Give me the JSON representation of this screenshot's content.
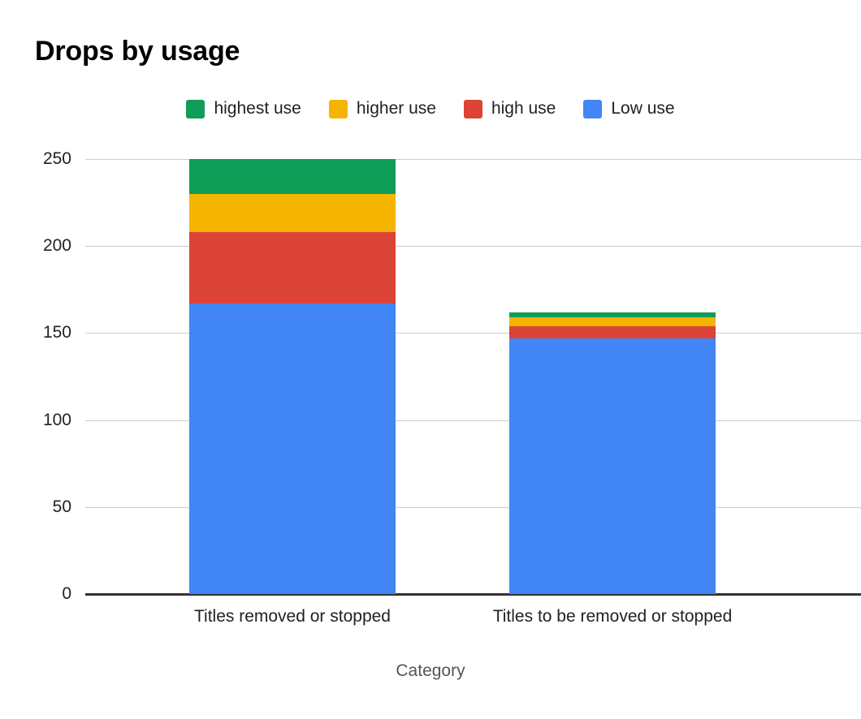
{
  "chart_data": {
    "type": "bar",
    "subtype": "stacked-column",
    "title": "Drops by usage",
    "xlabel": "Category",
    "ylabel": "",
    "categories": [
      "Titles removed or stopped",
      "Titles to be removed or stopped"
    ],
    "series": [
      {
        "name": "Low use",
        "color": "#4285f4",
        "values": [
          167,
          147
        ]
      },
      {
        "name": "high use",
        "color": "#db4437",
        "values": [
          41,
          7
        ]
      },
      {
        "name": "higher use",
        "color": "#f4b400",
        "values": [
          22,
          5
        ]
      },
      {
        "name": "highest use",
        "color": "#0f9d58",
        "values": [
          20,
          3
        ]
      }
    ],
    "stack_order_bottom_to_top": [
      "Low use",
      "high use",
      "higher use",
      "highest use"
    ],
    "totals": [
      250,
      162
    ],
    "ylim": [
      0,
      250
    ],
    "yticks": [
      "0",
      "50",
      "100",
      "150",
      "200",
      "250"
    ],
    "ytick_values": [
      0,
      50,
      100,
      150,
      200,
      250
    ],
    "grid": true,
    "legend_position": "top-center",
    "legend": [
      {
        "label": "highest use",
        "color": "#0f9d58"
      },
      {
        "label": "higher use",
        "color": "#f4b400"
      },
      {
        "label": "high use",
        "color": "#db4437"
      },
      {
        "label": "Low use",
        "color": "#4285f4"
      }
    ]
  },
  "colors": {
    "background": "#ffffff",
    "title_text": "#000000",
    "tick_text": "#222222",
    "axis_title_text": "#555555",
    "gridline": "#cccccc",
    "axisline": "#333333"
  }
}
